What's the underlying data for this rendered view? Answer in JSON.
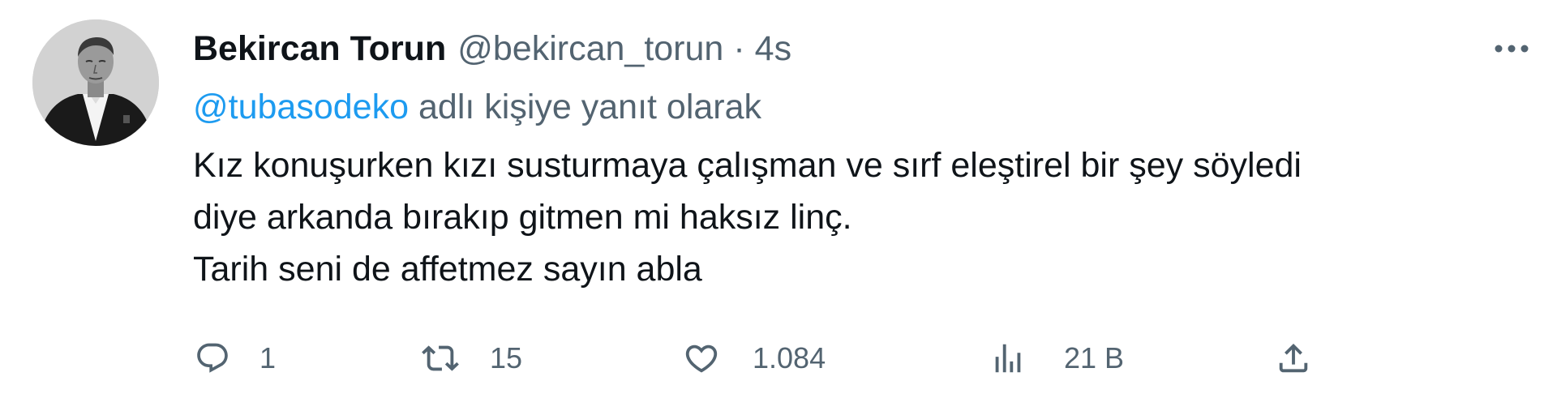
{
  "tweet": {
    "author_name": "Bekircan Torun",
    "author_handle": "@bekircan_torun",
    "separator": "·",
    "time": "4s",
    "reply_mention": "@tubasodeko",
    "reply_suffix": "adlı kişiye yanıt olarak",
    "body_lines": [
      "Kız konuşurken kızı susturmaya çalışman ve sırf eleştirel bir şey söyledi",
      "diye arkanda bırakıp gitmen mi haksız linç.",
      "Tarih seni de affetmez sayın abla"
    ]
  },
  "actions": {
    "reply": {
      "icon": "reply-icon",
      "count": "1"
    },
    "retweet": {
      "icon": "retweet-icon",
      "count": "15"
    },
    "like": {
      "icon": "heart-icon",
      "count": "1.084"
    },
    "views": {
      "icon": "views-icon",
      "count": "21 B"
    },
    "share": {
      "icon": "share-icon"
    }
  },
  "icons": {
    "more": "more-options-icon",
    "avatar": "profile-avatar"
  },
  "colors": {
    "text_primary": "#0f1419",
    "text_secondary": "#536471",
    "link": "#1d9bf0",
    "background": "#ffffff"
  }
}
